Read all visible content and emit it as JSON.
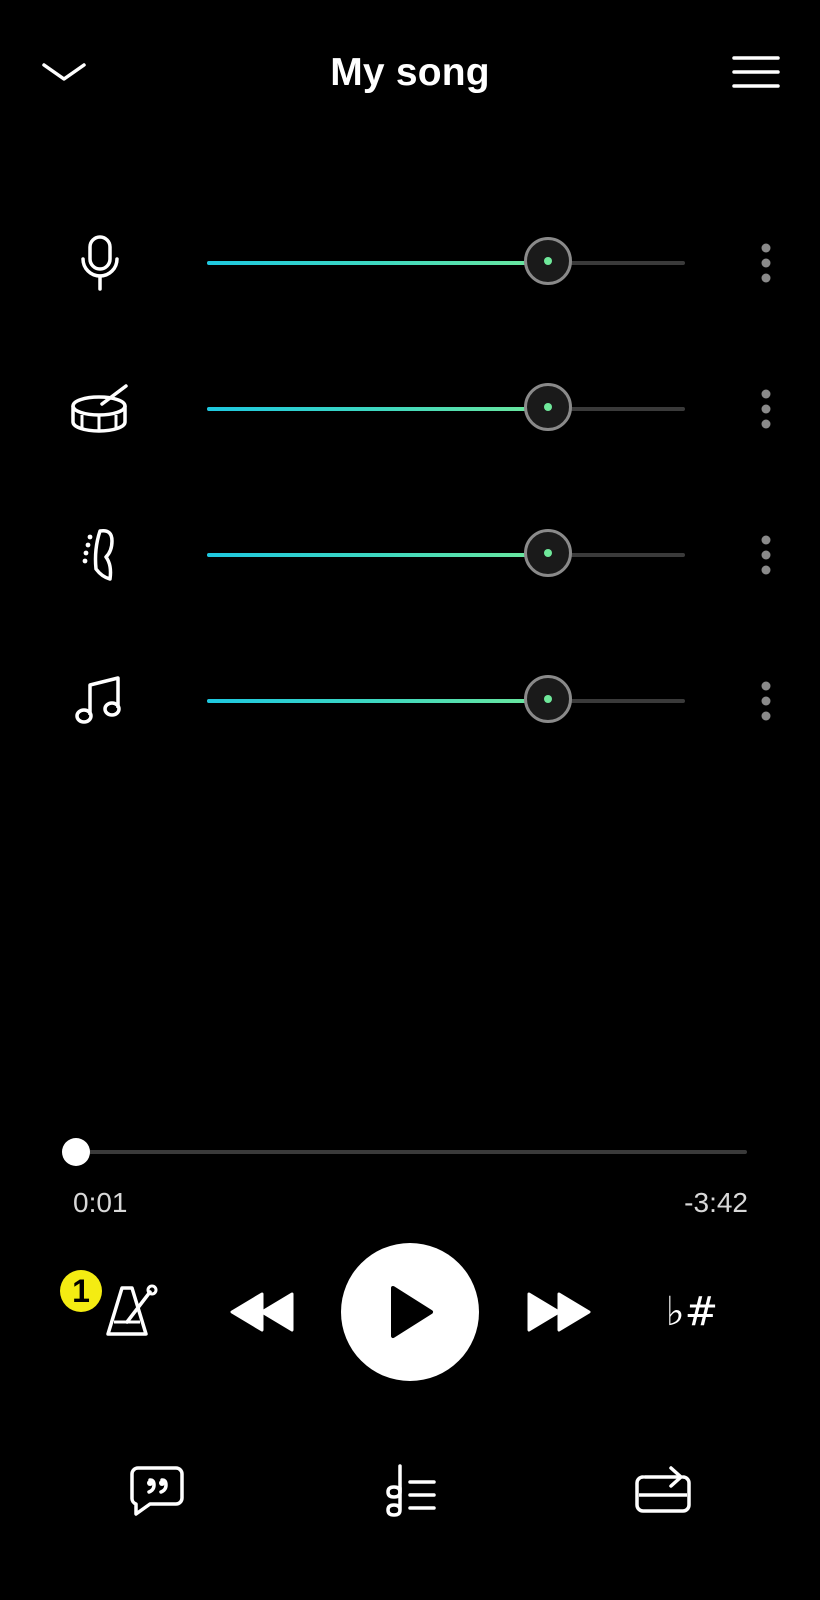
{
  "header": {
    "title": "My song",
    "collapse_icon": "chevron-down-icon",
    "menu_icon": "hamburger-menu-icon"
  },
  "tracks": [
    {
      "name": "vocals",
      "icon": "microphone-icon",
      "level": 0.72
    },
    {
      "name": "drums",
      "icon": "drum-icon",
      "level": 0.72
    },
    {
      "name": "bass",
      "icon": "bass-guitar-icon",
      "level": 0.72
    },
    {
      "name": "other",
      "icon": "music-note-icon",
      "level": 0.72
    }
  ],
  "playback": {
    "elapsed": "0:01",
    "remaining": "-3:42",
    "progress": 0.002
  },
  "controls": {
    "count_in_badge": "1",
    "pitch_label": "♭#",
    "metronome_icon": "metronome-icon",
    "rewind_icon": "rewind-icon",
    "play_icon": "play-icon",
    "fast_forward_icon": "fast-forward-icon"
  },
  "bottom_bar": {
    "lyrics_icon": "lyrics-quote-icon",
    "chords_icon": "chords-list-icon",
    "loop_icon": "loop-icon"
  },
  "colors": {
    "background": "#000000",
    "accent_start": "#1ec8e0",
    "accent_end": "#6fe89a",
    "badge": "#f4ec12"
  }
}
